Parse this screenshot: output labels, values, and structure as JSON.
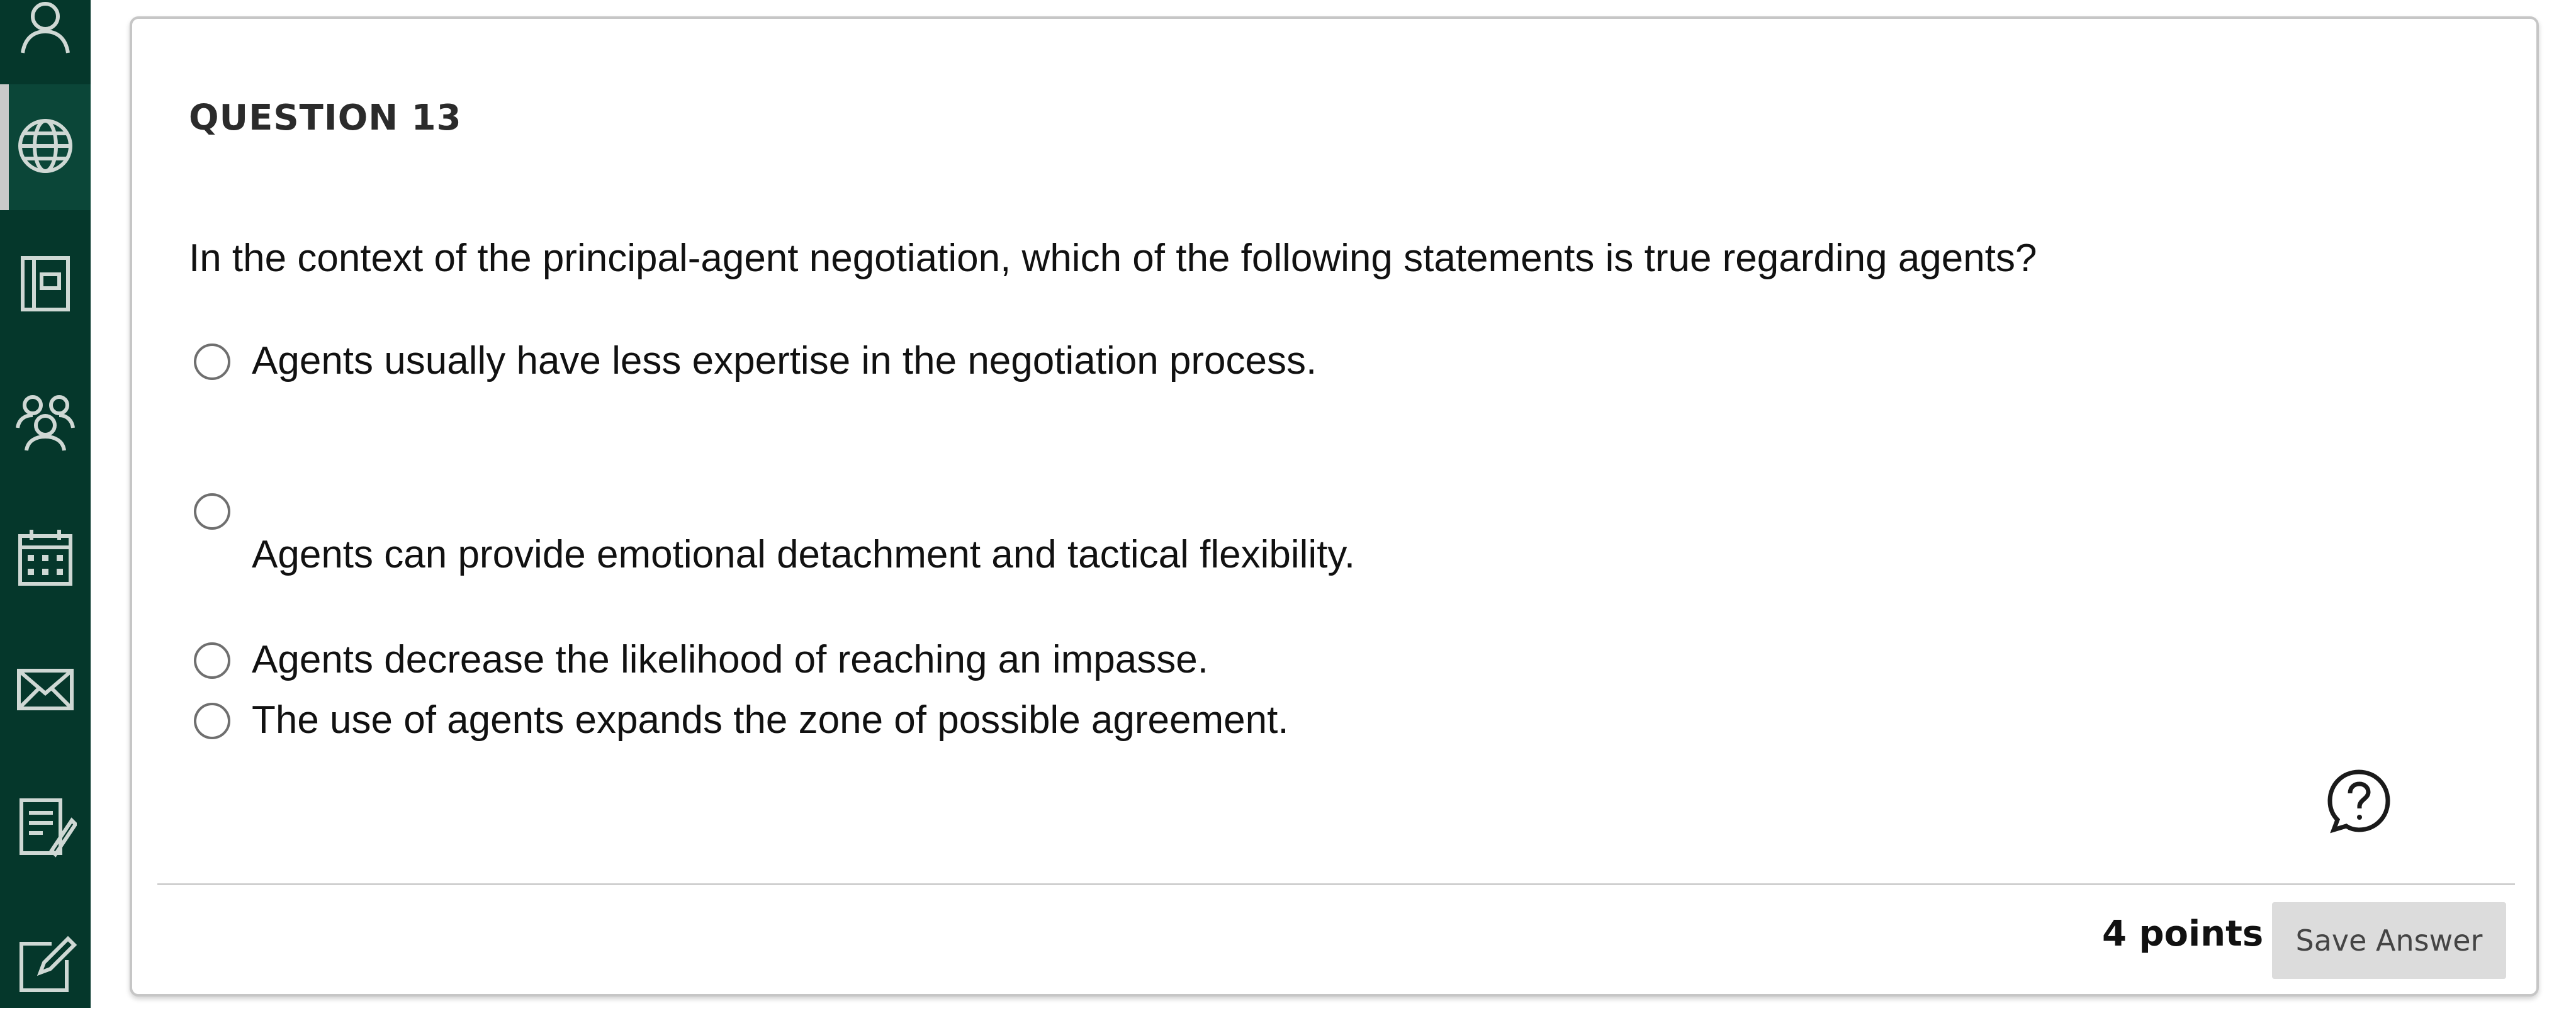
{
  "nav": {
    "items": [
      {
        "icon": "profile-icon"
      },
      {
        "icon": "globe-icon",
        "active": true
      },
      {
        "icon": "courses-icon"
      },
      {
        "icon": "groups-icon"
      },
      {
        "icon": "calendar-icon"
      },
      {
        "icon": "messages-icon"
      },
      {
        "icon": "grades-icon"
      },
      {
        "icon": "edit-icon"
      }
    ],
    "colors": {
      "background": "#05372b",
      "icon": "#cfd8d4"
    }
  },
  "question": {
    "number_label": "QUESTION 13",
    "prompt": "In the context of the principal-agent negotiation, which of the following statements is true regarding agents?",
    "options": [
      {
        "label": "Agents usually have less expertise in the negotiation process."
      },
      {
        "label": "Agents can provide emotional detachment and tactical flexibility."
      },
      {
        "label": "Agents decrease the likelihood of reaching an impasse."
      },
      {
        "label": "The use of agents expands the zone of possible agreement."
      }
    ],
    "help_icon": "help-question-icon",
    "points_label": "4 points",
    "save_label": "Save Answer"
  }
}
